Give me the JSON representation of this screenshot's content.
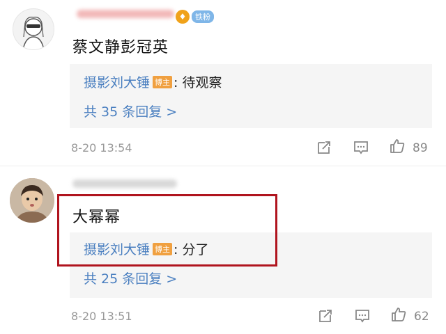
{
  "comments": [
    {
      "user_badge_label": "铁粉",
      "text": "蔡文静彭冠英",
      "reply": {
        "author": "摄影刘大锤",
        "author_badge": "博主",
        "text": ": 待观察"
      },
      "more_replies": "共 35 条回复 >",
      "timestamp": "8-20 13:54",
      "likes": "89"
    },
    {
      "text": "大幂幂",
      "reply": {
        "author": "摄影刘大锤",
        "author_badge": "博主",
        "text": ": 分了"
      },
      "more_replies": "共 25 条回复 >",
      "timestamp": "8-20 13:51",
      "likes": "62"
    }
  ],
  "colors": {
    "link": "#4a7fc0",
    "highlight_border": "#b0141e",
    "author_badge": "#f0a040"
  },
  "icons": [
    "share-icon",
    "comment-icon",
    "thumbs-up-icon"
  ]
}
